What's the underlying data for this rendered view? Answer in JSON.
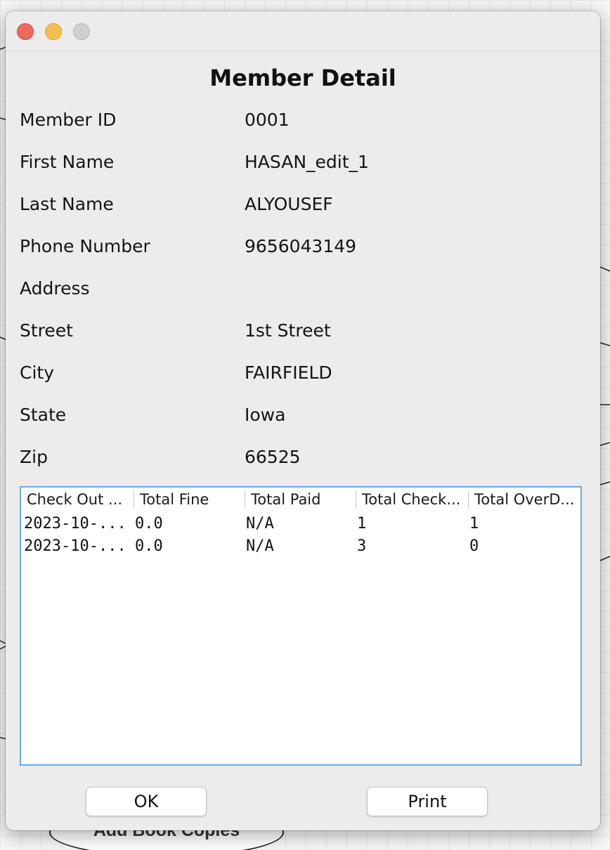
{
  "background": {
    "diagram_node_label": "Add Book Copies"
  },
  "dialog": {
    "title": "Member Detail",
    "fields": [
      {
        "label": "Member ID",
        "value": "0001"
      },
      {
        "label": "First Name",
        "value": "HASAN_edit_1"
      },
      {
        "label": "Last Name",
        "value": "ALYOUSEF"
      },
      {
        "label": "Phone Number",
        "value": "9656043149"
      },
      {
        "label": "Address",
        "value": ""
      },
      {
        "label": "Street",
        "value": "1st Street"
      },
      {
        "label": "City",
        "value": "FAIRFIELD"
      },
      {
        "label": "State",
        "value": "Iowa"
      },
      {
        "label": "Zip",
        "value": "66525"
      }
    ],
    "table": {
      "columns": [
        "Check Out ...",
        "Total Fine",
        "Total Paid",
        "Total Check...",
        "Total OverD..."
      ],
      "rows": [
        [
          "2023-10-...",
          "0.0",
          "N/A",
          "1",
          "1"
        ],
        [
          "2023-10-...",
          "0.0",
          "N/A",
          "3",
          "0"
        ]
      ]
    },
    "buttons": {
      "ok": "OK",
      "print": "Print"
    }
  },
  "window_controls": {
    "close_icon": "close-icon",
    "minimize_icon": "minimize-icon",
    "zoom_icon": "zoom-icon",
    "colors": {
      "close": "#ec6a5e",
      "minimize": "#f4bf4f",
      "zoom": "#cfcfcf"
    }
  },
  "colors": {
    "table_focus_border": "#6aa9e6",
    "dialog_background": "#ececec"
  }
}
